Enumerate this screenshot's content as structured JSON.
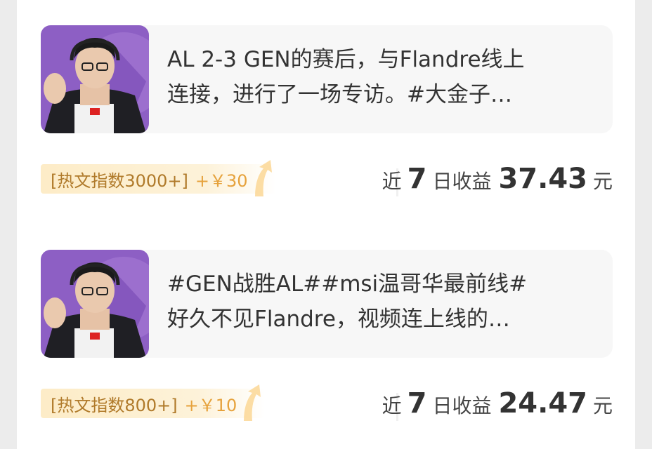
{
  "posts": [
    {
      "title_line1": "AL 2-3 GEN的赛后，与Flandre线上",
      "title_line2": "连接，进行了一场专访。#大金子…",
      "badge_text": "[热文指数3000+]",
      "badge_reward": "+￥30",
      "earn_prefix": "近",
      "earn_days": "7",
      "earn_mid": "日收益",
      "earn_amount": "37.43",
      "earn_unit": "元"
    },
    {
      "title_line1": "#GEN战胜AL##msi温哥华最前线#",
      "title_line2": "好久不见Flandre，视频连上线的…",
      "badge_text": "[热文指数800+]",
      "badge_reward": "+￥10",
      "earn_prefix": "近",
      "earn_days": "7",
      "earn_mid": "日收益",
      "earn_amount": "24.47",
      "earn_unit": "元"
    }
  ],
  "colors": {
    "thumb_bg": "#8d5fc4",
    "badge_text": "#b07a2a",
    "badge_reward": "#e6a23c",
    "card_bg": "#f7f7f7"
  }
}
